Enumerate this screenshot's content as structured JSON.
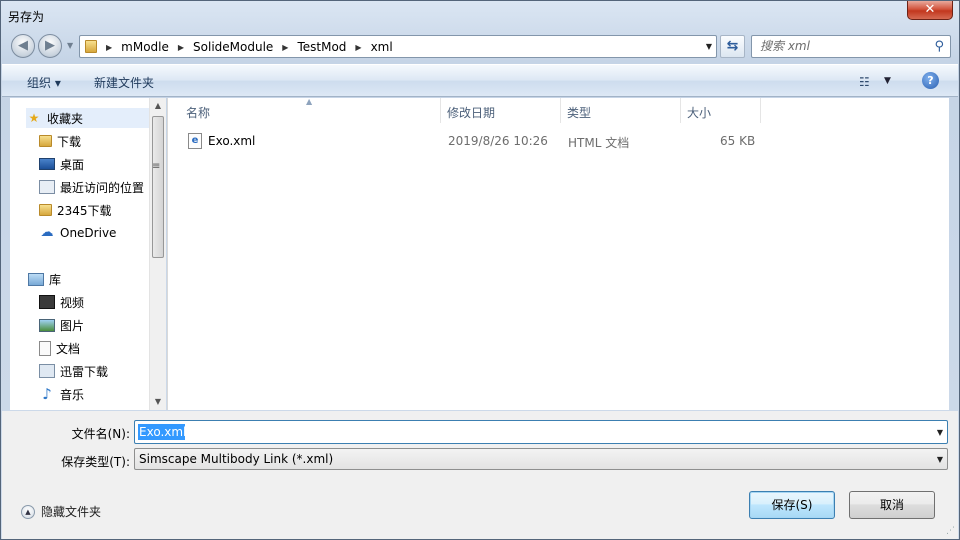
{
  "window": {
    "title": "另存为",
    "close_label": "✕"
  },
  "address": {
    "crumbs": [
      "mModle",
      "SolideModule",
      "TestMod",
      "xml"
    ]
  },
  "search": {
    "placeholder": "搜索 xml"
  },
  "toolbar": {
    "organize_label": "组织 ▾",
    "new_folder_label": "新建文件夹"
  },
  "nav": {
    "favorites": {
      "label": "收藏夹",
      "items": [
        "下载",
        "桌面",
        "最近访问的位置",
        "2345下载",
        "OneDrive"
      ]
    },
    "library": {
      "label": "库",
      "items": [
        "视频",
        "图片",
        "文档",
        "迅雷下载",
        "音乐"
      ]
    }
  },
  "columns": [
    "名称",
    "修改日期",
    "类型",
    "大小"
  ],
  "files": [
    {
      "name": "Exo.xml",
      "modified": "2019/8/26 10:26",
      "type": "HTML 文档",
      "size": "65 KB"
    }
  ],
  "form": {
    "filename_label": "文件名(N):",
    "filename_value": "Exo.xml",
    "filetype_label": "保存类型(T):",
    "filetype_value": "Simscape Multibody Link (*.xml)"
  },
  "buttons": {
    "save": "保存(S)",
    "cancel": "取消"
  },
  "hide_folders_label": "隐藏文件夹",
  "colors": {
    "accent": "#3399ff",
    "title_close": "#c2371e"
  }
}
